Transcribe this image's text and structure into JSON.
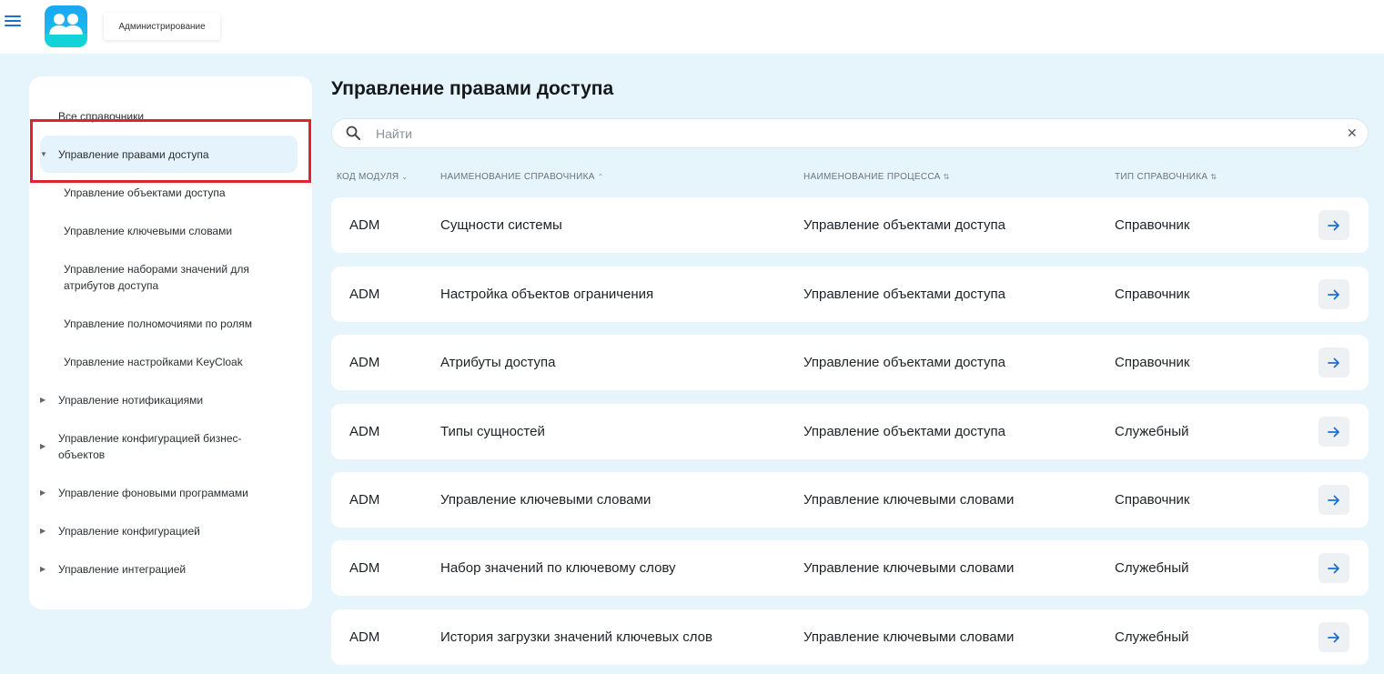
{
  "header": {
    "app_tab_label": "Администрирование"
  },
  "sidebar": {
    "items": [
      {
        "label": "Все справочники"
      },
      {
        "label": "Управление правами доступа"
      },
      {
        "label": "Управление объектами доступа"
      },
      {
        "label": "Управление ключевыми словами"
      },
      {
        "label": "Управление наборами значений для атрибутов доступа"
      },
      {
        "label": "Управление полномочиями по ролям"
      },
      {
        "label": "Управление настройками KeyCloak"
      },
      {
        "label": "Управление нотификациями"
      },
      {
        "label": "Управление конфигурацией бизнес-объектов"
      },
      {
        "label": "Управление фоновыми программами"
      },
      {
        "label": "Управление конфигурацией"
      },
      {
        "label": "Управление интеграцией"
      }
    ]
  },
  "main": {
    "title": "Управление правами доступа",
    "search": {
      "placeholder": "Найти",
      "value": ""
    },
    "columns": [
      "КОД МОДУЛЯ",
      "НАИМЕНОВАНИЕ СПРАВОЧНИКА",
      "НАИМЕНОВАНИЕ ПРОЦЕССА",
      "ТИП СПРАВОЧНИКА"
    ],
    "rows": [
      {
        "code": "ADM",
        "name": "Сущности системы",
        "process": "Управление объектами доступа",
        "type": "Справочник"
      },
      {
        "code": "ADM",
        "name": "Настройка объектов ограничения",
        "process": "Управление объектами доступа",
        "type": "Справочник"
      },
      {
        "code": "ADM",
        "name": "Атрибуты доступа",
        "process": "Управление объектами доступа",
        "type": "Справочник"
      },
      {
        "code": "ADM",
        "name": "Типы сущностей",
        "process": "Управление объектами доступа",
        "type": "Служебный"
      },
      {
        "code": "ADM",
        "name": "Управление ключевыми словами",
        "process": "Управление ключевыми словами",
        "type": "Справочник"
      },
      {
        "code": "ADM",
        "name": "Набор значений по ключевому слову",
        "process": "Управление ключевыми словами",
        "type": "Служебный"
      },
      {
        "code": "ADM",
        "name": "История загрузки значений ключевых слов",
        "process": "Управление ключевыми словами",
        "type": "Служебный"
      }
    ]
  },
  "colors": {
    "accent": "#1f6fd1",
    "page_bg": "#e6f5fc",
    "highlight": "#e0242d"
  }
}
